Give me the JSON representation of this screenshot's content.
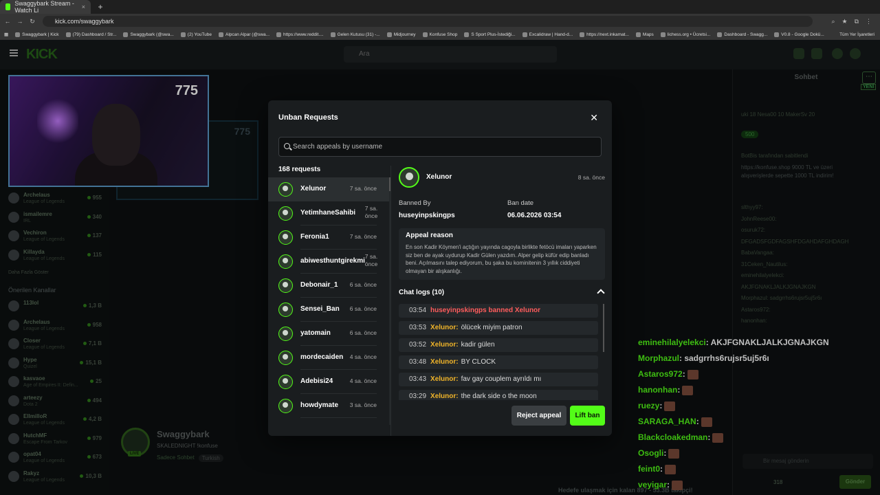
{
  "browser": {
    "tab_title": "Swaggybark Stream - Watch Li",
    "url": "kick.com/swaggybark",
    "bookmarks": [
      "Swaggybark | Kick",
      "(79) Dashboard / Str...",
      "Swaggybark (@swa...",
      "(2) YouTube",
      "Alpcan Alpar (@swa...",
      "https://www.reddit....",
      "Gelen Kutusu (31) -...",
      "Midjourney",
      "Konfuse Shop",
      "S Sport Plus-İstediği...",
      "Excalidraw | Hand-d...",
      "https://next.inkamat...",
      "Maps",
      "lichess.org • Ücretsi...",
      "Dashboard - Swagg...",
      "V0.8 - Google Dokü..."
    ],
    "all_bookmarks": "Tüm Yer İşaretleri"
  },
  "kick": {
    "logo": "KICK",
    "search_placeholder": "Ara",
    "pip_score": "775",
    "ghost_score": "775"
  },
  "sidebar": {
    "top_channels": [
      {
        "name": "Archelaus",
        "game": "League of Legends",
        "viewers": "955"
      },
      {
        "name": "ismailemre",
        "game": "IRL",
        "viewers": "340"
      },
      {
        "name": "Vechiron",
        "game": "League of Legends",
        "viewers": "137"
      },
      {
        "name": "Killayda",
        "game": "League of Legends",
        "viewers": "115"
      }
    ],
    "show_more": "Daha Fazla Göster",
    "recommended_title": "Önerilen Kanallar",
    "recommended": [
      {
        "name": "113lol",
        "game": "",
        "viewers": "1,3 B"
      },
      {
        "name": "Archelaus",
        "game": "League of Legends",
        "viewers": "958"
      },
      {
        "name": "Closer",
        "game": "League of Legends",
        "viewers": "7,1 B"
      },
      {
        "name": "Hype",
        "game": "Quizel",
        "viewers": "15,1 B"
      },
      {
        "name": "kasvaoe",
        "game": "Age of Empires II: Defin...",
        "viewers": "25"
      },
      {
        "name": "arteezy",
        "game": "Dota 2",
        "viewers": "494"
      },
      {
        "name": "EllmilloR",
        "game": "League of Legends",
        "viewers": "4,2 B"
      },
      {
        "name": "HutchMF",
        "game": "Escape From Tarkov",
        "viewers": "979"
      },
      {
        "name": "opat04",
        "game": "League of Legends",
        "viewers": "673"
      },
      {
        "name": "Rakyz",
        "game": "League of Legends",
        "viewers": "10,3 B"
      }
    ]
  },
  "streamer": {
    "name": "Swaggybark",
    "title": "SKALEDNIGHT !konfuse",
    "live": "LIVE",
    "tag1": "Sadece Sohbet",
    "tag2": "Turkish",
    "goal_text": "Hedefe ulaşmak için kalan 897 - 53.3B takipçi!"
  },
  "chat": {
    "title": "Sohbet",
    "new_badge": "YENİ",
    "leaders": "uki 18   Nesa00 10   MakerSv 20",
    "points_badge": "500",
    "pinned_by": "BotBis tarafından sabitlendi",
    "pinned_msg": "https://konfuse.shop 9000 TL ve üzeri alışverişlerde sepette 1000 TL indirim!",
    "dim_lines": [
      "slthyy97:",
      "JohnReese00:",
      "osuruk72:",
      "DFGADSFGDFAGSHFDGAHDAFGHDAGH",
      "BabaVangaa:",
      "31Ceken_Nautilus:",
      "eminehilalyelekci:",
      "AKJFGNAKLJALKJGNAJKGN",
      "Morphazul: sadgrrhs6rujsr5uj5r6ı",
      "Astaros972:",
      "hanonhan:"
    ],
    "overlay": [
      {
        "user": "eminehilalyelekci",
        "msg": ": AKJFGNAKLJALKJGNAJKGN"
      },
      {
        "user": "Morphazul",
        "msg": ": sadgrrhs6rujsr5uj5r6ı"
      },
      {
        "user": "Astaros972",
        "msg": ":"
      },
      {
        "user": "hanonhan",
        "msg": ":"
      },
      {
        "user": "ruezy",
        "msg": ":"
      },
      {
        "user": "SARAGA_HAN",
        "msg": ":"
      },
      {
        "user": "Blackcloakedman",
        "msg": ":"
      },
      {
        "user": "Osogli",
        "msg": ":"
      },
      {
        "user": "feint0",
        "msg": ":"
      },
      {
        "user": "veyigar",
        "msg": ":"
      }
    ],
    "input_placeholder": "Bir mesaj gönderin",
    "points": "318",
    "send": "Gönder"
  },
  "modal": {
    "title": "Unban Requests",
    "search_placeholder": "Search appeals by username",
    "count": "168 requests",
    "requests": [
      {
        "name": "Xelunor",
        "time": "7 sa. önce"
      },
      {
        "name": "YetimhaneSahibi",
        "time": "7 sa. önce"
      },
      {
        "name": "Feronia1",
        "time": "7 sa. önce"
      },
      {
        "name": "abiwesthuntgirekmi",
        "time": "7 sa. önce"
      },
      {
        "name": "Debonair_1",
        "time": "6 sa. önce"
      },
      {
        "name": "Sensei_Ban",
        "time": "6 sa. önce"
      },
      {
        "name": "yatomain",
        "time": "6 sa. önce"
      },
      {
        "name": "mordecaiden",
        "time": "4 sa. önce"
      },
      {
        "name": "Adebisi24",
        "time": "4 sa. önce"
      },
      {
        "name": "howdymate",
        "time": "3 sa. önce"
      }
    ],
    "detail": {
      "name": "Xelunor",
      "time": "8 sa. önce",
      "banned_by_label": "Banned By",
      "banned_by": "huseyinpskingps",
      "ban_date_label": "Ban date",
      "ban_date": "06.06.2026 03:54",
      "appeal_title": "Appeal reason",
      "appeal_text": "En son Kadir Köymen'i açtığın yayında cagoyla birlikte fetöcü imaları yaparken siz ben de ayak uydurup Kadir Gülen yazdım. Alper gelip küfür edip banladı beni. Açılmasını talep ediyorum, bu şaka bu kominitenin 3 yıllık ciddiyeti olmayan bir alışkanlığı.",
      "logs_title": "Chat logs (10)",
      "logs": [
        {
          "time": "03:54",
          "user": "huseyinpskingps banned Xelunor",
          "msg": "",
          "ban": true
        },
        {
          "time": "03:53",
          "user": "Xelunor:",
          "msg": "ölücek miyim patron",
          "ban": false
        },
        {
          "time": "03:52",
          "user": "Xelunor:",
          "msg": "kadir gülen",
          "ban": false
        },
        {
          "time": "03:48",
          "user": "Xelunor:",
          "msg": "BY CLOCK",
          "ban": false
        },
        {
          "time": "03:43",
          "user": "Xelunor:",
          "msg": "fav gay couplem ayrıldı mı",
          "ban": false
        },
        {
          "time": "03:29",
          "user": "Xelunor:",
          "msg": "the dark side o the moon",
          "ban": false
        }
      ]
    },
    "reject": "Reject appeal",
    "lift": "Lift ban"
  },
  "colors": {
    "accent": "#53fc18",
    "danger": "#ff5c5c",
    "username": "#f0b429"
  }
}
